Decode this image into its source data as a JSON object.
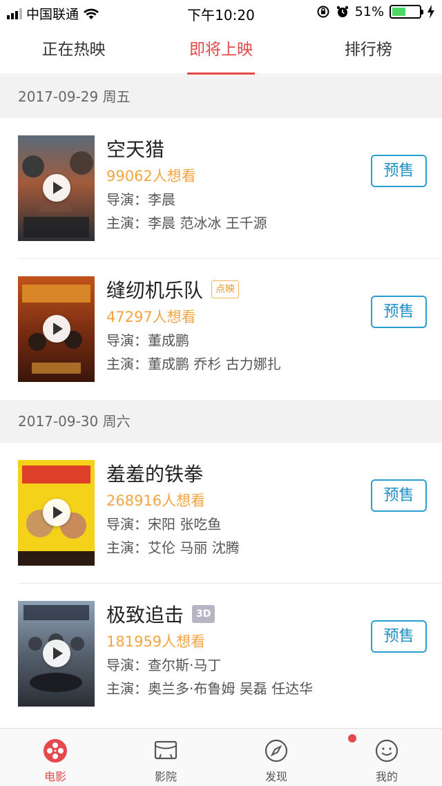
{
  "status_bar": {
    "carrier": "中国联通",
    "time": "下午10:20",
    "battery": "51%",
    "battery_level": 0.51
  },
  "tabs": [
    {
      "label": "正在热映",
      "active": false
    },
    {
      "label": "即将上映",
      "active": true
    },
    {
      "label": "排行榜",
      "active": false
    }
  ],
  "sections": [
    {
      "date": "2017-09-29 周五",
      "movies": [
        {
          "title": "空天猎",
          "tag": "",
          "want": "99062人想看",
          "director_label": "导演：",
          "director": "李晨",
          "cast_label": "主演：",
          "cast": "李晨 范冰冰 王千源",
          "button": "预售"
        },
        {
          "title": "缝纫机乐队",
          "tag": "点映",
          "want": "47297人想看",
          "director_label": "导演：",
          "director": "董成鹏",
          "cast_label": "主演：",
          "cast": "董成鹏 乔杉 古力娜扎",
          "button": "预售"
        }
      ]
    },
    {
      "date": "2017-09-30 周六",
      "movies": [
        {
          "title": "羞羞的铁拳",
          "tag": "",
          "want": "268916人想看",
          "director_label": "导演：",
          "director": "宋阳 张吃鱼",
          "cast_label": "主演：",
          "cast": "艾伦 马丽 沈腾",
          "button": "预售"
        },
        {
          "title": "极致追击",
          "tag": "3D",
          "want": "181959人想看",
          "director_label": "导演：",
          "director": "查尔斯·马丁",
          "cast_label": "主演：",
          "cast": "奥兰多·布鲁姆 吴磊 任达华",
          "button": "预售"
        }
      ]
    }
  ],
  "bottom_nav": [
    {
      "label": "电影",
      "icon": "film-reel-icon",
      "active": true
    },
    {
      "label": "影院",
      "icon": "cinema-icon",
      "active": false
    },
    {
      "label": "发现",
      "icon": "compass-icon",
      "active": false,
      "badge": true
    },
    {
      "label": "我的",
      "icon": "profile-icon",
      "active": false
    }
  ],
  "colors": {
    "accent": "#e54847",
    "want_count": "#f5a442",
    "presale_button": "#2a9fcf"
  }
}
